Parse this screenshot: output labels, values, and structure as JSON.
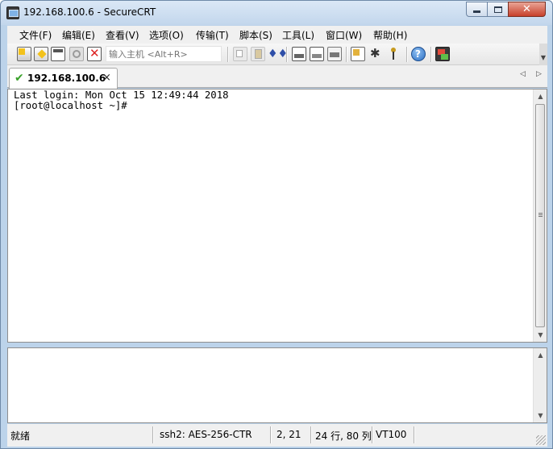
{
  "window": {
    "title": "192.168.100.6 - SecureCRT"
  },
  "menu": [
    "文件(F)",
    "编辑(E)",
    "查看(V)",
    "选项(O)",
    "传输(T)",
    "脚本(S)",
    "工具(L)",
    "窗口(W)",
    "帮助(H)"
  ],
  "toolbar": {
    "quick_connect_placeholder": "输入主机 <Alt+R>",
    "icons": [
      "connect-icon",
      "quick-connect-icon",
      "connect-in-tab-icon",
      "reconnect-icon",
      "disconnect-icon",
      "copy-icon",
      "paste-icon",
      "find-icon",
      "print-icon",
      "print-selection-icon",
      "print-setup-icon",
      "session-options-icon",
      "global-options-icon",
      "keymap-icon",
      "help-icon",
      "keygen-icon"
    ]
  },
  "tab": {
    "label": "192.168.100.6",
    "close_symbol": "×"
  },
  "terminal": {
    "lines": [
      "Last login: Mon Oct 15 12:49:44 2018",
      "[root@localhost ~]#"
    ]
  },
  "status": {
    "state": "就绪",
    "cipher": "ssh2: AES-256-CTR",
    "cursor": "2,  21",
    "size": "24 行, 80 列",
    "emulation": "VT100"
  }
}
